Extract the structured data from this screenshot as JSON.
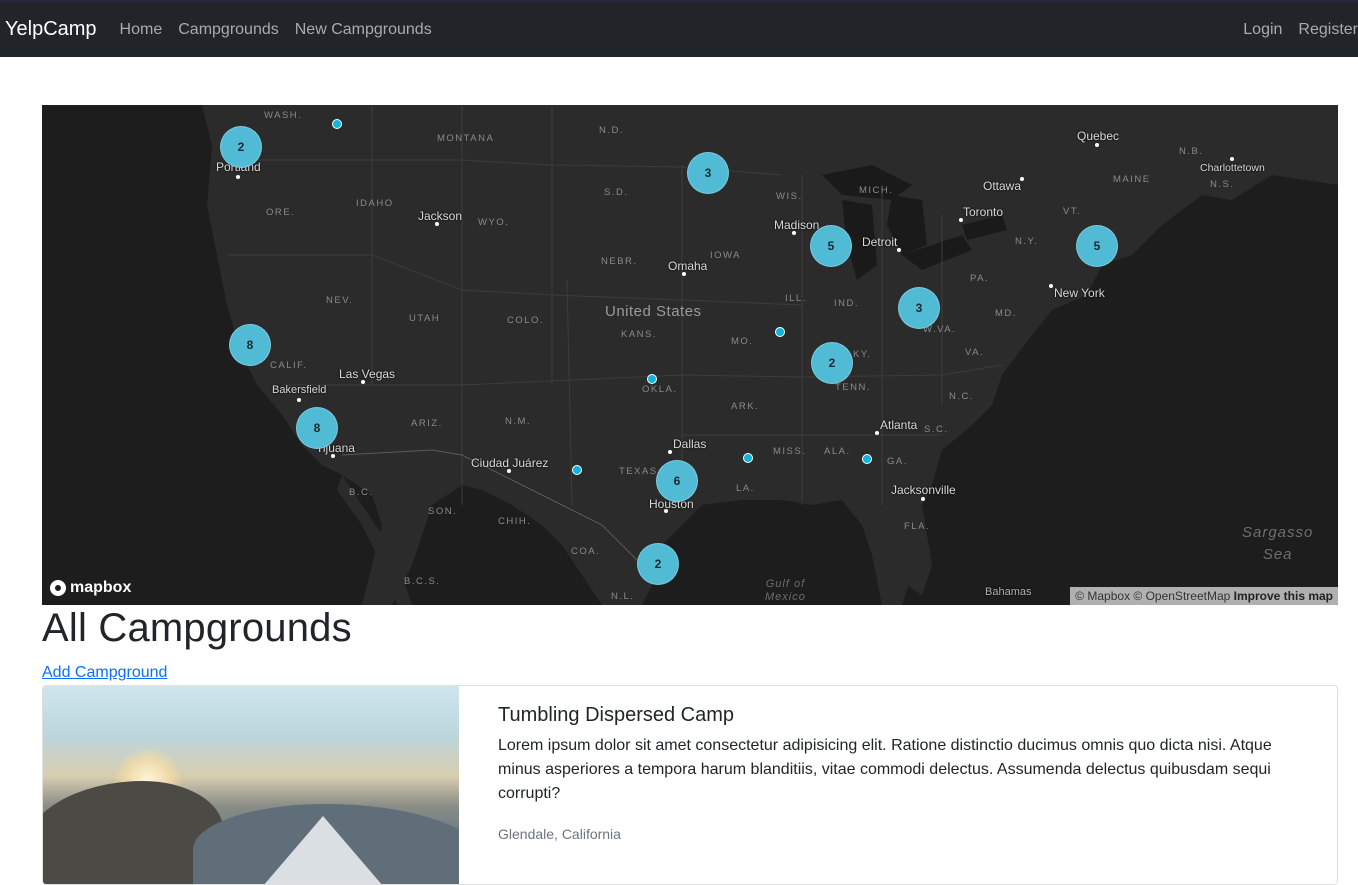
{
  "navbar": {
    "brand": "YelpCamp",
    "links": [
      "Home",
      "Campgrounds",
      "New Campgrounds"
    ],
    "right_links": [
      "Login",
      "Register"
    ]
  },
  "map": {
    "country_label": "United States",
    "clusters": [
      {
        "count": "2"
      },
      {
        "count": "3"
      },
      {
        "count": "5"
      },
      {
        "count": "5"
      },
      {
        "count": "3"
      },
      {
        "count": "8"
      },
      {
        "count": "2"
      },
      {
        "count": "8"
      },
      {
        "count": "6"
      },
      {
        "count": "2"
      }
    ],
    "cities": [
      "Portland",
      "Jackson",
      "Omaha",
      "Madison",
      "Detroit",
      "Toronto",
      "Ottawa",
      "Quebec",
      "Charlottetown",
      "New York",
      "Las Vegas",
      "Bakersfield",
      "Tijuana",
      "Ciudad Juárez",
      "Dallas",
      "Houston",
      "Atlanta",
      "Jacksonville",
      "Bahamas"
    ],
    "states": [
      "WASH.",
      "MONTANA",
      "N.D.",
      "ORE.",
      "IDAHO",
      "WYO.",
      "S.D.",
      "WIS.",
      "MICH.",
      "N.B.",
      "MAINE",
      "N.S.",
      "VT.",
      "N.Y.",
      "NEBR.",
      "IOWA",
      "PA.",
      "NEV.",
      "UTAH",
      "COLO.",
      "ILL.",
      "IND.",
      "KANS.",
      "MO.",
      "W.VA.",
      "MD.",
      "VA.",
      "CALIF.",
      "KY.",
      "OKLA.",
      "TENN.",
      "N.C.",
      "ARIZ.",
      "N.M.",
      "ARK.",
      "MISS.",
      "ALA.",
      "S.C.",
      "GA.",
      "TEXAS",
      "LA.",
      "B.C.",
      "SON.",
      "CHIH.",
      "FLA.",
      "COA.",
      "B.C.S.",
      "N.L."
    ],
    "water_labels": {
      "sargasso": "Sargasso\nSea",
      "gulf": "Gulf of\nMexico"
    },
    "logo_text": "mapbox",
    "attribution": "© Mapbox © OpenStreetMap",
    "improve_link": "Improve this map"
  },
  "page": {
    "title": "All Campgrounds",
    "add_link": "Add Campground"
  },
  "campground": {
    "title": "Tumbling Dispersed Camp",
    "description": "Lorem ipsum dolor sit amet consectetur adipisicing elit. Ratione distinctio ducimus omnis quo dicta nisi. Atque minus asperiores a tempora harum blanditiis, vitae commodi delectus. Assumenda delectus quibusdam sequi corrupti?",
    "location": "Glendale, California"
  },
  "colors": {
    "navbar_bg": "#212529",
    "map_bg": "#1d1d1d",
    "cluster": "#51bbd6",
    "point": "#11b4da",
    "link": "#0d6efd"
  }
}
